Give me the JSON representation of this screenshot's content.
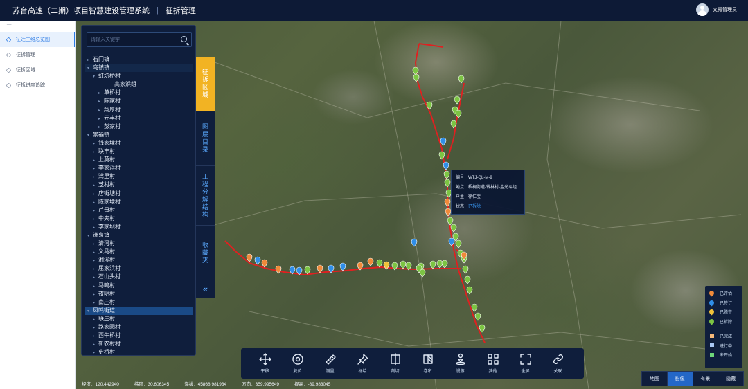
{
  "header": {
    "title": "苏台高速（二期）项目智慧建设管理系统",
    "separator": "|",
    "module": "征拆管理",
    "user": "文殿管理员"
  },
  "sidebar": {
    "collapse_icon": "menu-fold-icon",
    "items": [
      {
        "label": "征迁三维总览图",
        "active": true
      },
      {
        "label": "征拆管理",
        "active": false
      },
      {
        "label": "征拆区域",
        "active": false
      },
      {
        "label": "征拆进度追踪",
        "active": false
      }
    ]
  },
  "search": {
    "placeholder": "请输入关键字"
  },
  "tree": [
    {
      "label": "石门镇",
      "level": 1,
      "arrow": "▸"
    },
    {
      "label": "乌镇镇",
      "level": 1,
      "arrow": "▾",
      "style": "group"
    },
    {
      "label": "虹坊桥村",
      "level": 2,
      "arrow": "▾"
    },
    {
      "label": "高家浜组",
      "level": 4,
      "arrow": ""
    },
    {
      "label": "单桥村",
      "level": 3,
      "arrow": "▸"
    },
    {
      "label": "陈家村",
      "level": 3,
      "arrow": "▸"
    },
    {
      "label": "翔厚村",
      "level": 3,
      "arrow": "▸"
    },
    {
      "label": "元丰村",
      "level": 3,
      "arrow": "▸"
    },
    {
      "label": "彭家村",
      "level": 3,
      "arrow": "▸"
    },
    {
      "label": "崇福镇",
      "level": 1,
      "arrow": "▾"
    },
    {
      "label": "钱家埭村",
      "level": 2,
      "arrow": "▸"
    },
    {
      "label": "联丰村",
      "level": 2,
      "arrow": "▸"
    },
    {
      "label": "上莫村",
      "level": 2,
      "arrow": "▸"
    },
    {
      "label": "李家浜村",
      "level": 2,
      "arrow": "▸"
    },
    {
      "label": "湾里村",
      "level": 2,
      "arrow": "▸"
    },
    {
      "label": "芝村村",
      "level": 2,
      "arrow": "▸"
    },
    {
      "label": "店街塘村",
      "level": 2,
      "arrow": "▸"
    },
    {
      "label": "陈家埭村",
      "level": 2,
      "arrow": "▸"
    },
    {
      "label": "芦母村",
      "level": 2,
      "arrow": "▸"
    },
    {
      "label": "中夫村",
      "level": 2,
      "arrow": "▸"
    },
    {
      "label": "李家坝村",
      "level": 2,
      "arrow": "▸"
    },
    {
      "label": "洲泉镇",
      "level": 1,
      "arrow": "▾"
    },
    {
      "label": "清河村",
      "level": 2,
      "arrow": "▸"
    },
    {
      "label": "义马村",
      "level": 2,
      "arrow": "▸"
    },
    {
      "label": "湘溪村",
      "level": 2,
      "arrow": "▸"
    },
    {
      "label": "屈家浜村",
      "level": 2,
      "arrow": "▸"
    },
    {
      "label": "石山头村",
      "level": 2,
      "arrow": "▸"
    },
    {
      "label": "马鸣村",
      "level": 2,
      "arrow": "▸"
    },
    {
      "label": "夜明村",
      "level": 2,
      "arrow": "▸"
    },
    {
      "label": "南庄村",
      "level": 2,
      "arrow": "▸"
    },
    {
      "label": "凤鸣街道",
      "level": 1,
      "arrow": "▾",
      "style": "hl"
    },
    {
      "label": "联庄村",
      "level": 2,
      "arrow": "▸"
    },
    {
      "label": "路家园村",
      "level": 2,
      "arrow": "▸"
    },
    {
      "label": "西牛桥村",
      "level": 2,
      "arrow": "▸"
    },
    {
      "label": "新农村村",
      "level": 2,
      "arrow": "▸"
    },
    {
      "label": "史桥村",
      "level": 2,
      "arrow": "▸"
    }
  ],
  "vtabs": [
    {
      "label": "征拆区域",
      "active": true
    },
    {
      "label": "图层目录",
      "active": false
    },
    {
      "label": "工程分解结构",
      "active": false
    },
    {
      "label": "收藏夹",
      "active": false
    }
  ],
  "popup": {
    "id_label": "编号：",
    "id_value": "WTJ-QL-M-9",
    "loc_label": "地点：",
    "loc_value": "梧桐街道-钱林村-金光斗组",
    "owner_label": "户主：",
    "owner_value": "徐仁宝",
    "status_label": "状态：",
    "status_value": "已拆除"
  },
  "legend": [
    {
      "label": "已评估",
      "kind": "pin",
      "color": "#f08a3a"
    },
    {
      "label": "已签订",
      "kind": "pin",
      "color": "#2f8ee8"
    },
    {
      "label": "已腾空",
      "kind": "pin",
      "color": "#f0c23a"
    },
    {
      "label": "已拆除",
      "kind": "pin",
      "color": "#7cc443"
    },
    {
      "label": "已完成",
      "kind": "sq",
      "color": "#f7b97a"
    },
    {
      "label": "进行中",
      "kind": "sq",
      "color": "#a9c8f5"
    },
    {
      "label": "未开始",
      "kind": "sq",
      "color": "#6ed67a"
    }
  ],
  "toolbar": [
    {
      "label": "平移",
      "icon": "move-icon"
    },
    {
      "label": "复位",
      "icon": "reset-icon"
    },
    {
      "label": "测量",
      "icon": "ruler-icon"
    },
    {
      "label": "标绘",
      "icon": "pin-icon"
    },
    {
      "label": "剖切",
      "icon": "section-icon"
    },
    {
      "label": "卷帘",
      "icon": "curtain-icon"
    },
    {
      "label": "漫游",
      "icon": "walk-icon"
    },
    {
      "label": "其他",
      "icon": "grid-icon"
    },
    {
      "label": "全屏",
      "icon": "fullscreen-icon"
    },
    {
      "label": "关联",
      "icon": "link-icon"
    }
  ],
  "status": {
    "lon": "经度：120.442940",
    "lat": "纬度：30.606345",
    "alt": "海拔：45868.981934",
    "heading": "方向：359.995649",
    "pitch": "视高：-89.983045"
  },
  "layers": [
    {
      "label": "地图",
      "active": false
    },
    {
      "label": "影像",
      "active": true
    },
    {
      "label": "有景",
      "active": false
    },
    {
      "label": "隐藏",
      "active": false
    }
  ],
  "colors": {
    "route": "#e02020",
    "accent": "#2367c7",
    "tab_active": "#f2b323",
    "panel": "#0f1e3c"
  }
}
